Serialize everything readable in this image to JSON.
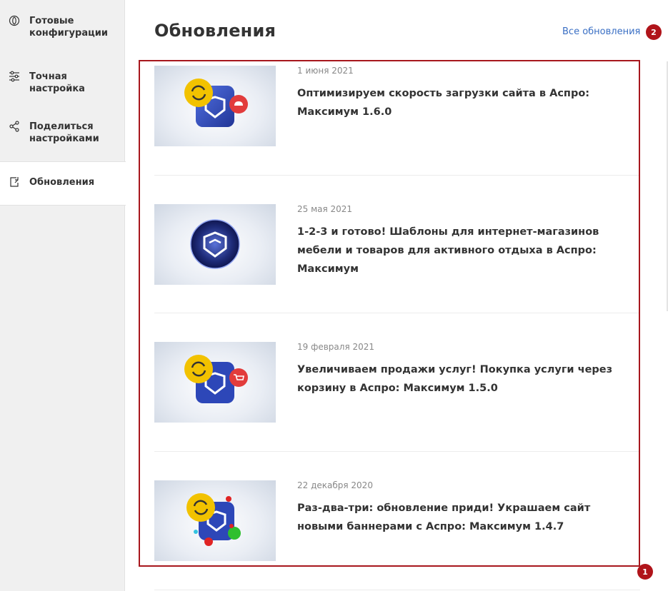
{
  "sidebar": {
    "items": [
      {
        "label_line1": "Готовые",
        "label_line2": "конфигурации",
        "icon": "palette-icon"
      },
      {
        "label_line1": "Точная",
        "label_line2": "настройка",
        "icon": "sliders-icon"
      },
      {
        "label_line1": "Поделиться",
        "label_line2": "настройками",
        "icon": "share-icon"
      },
      {
        "label_line1": "Обновления",
        "icon": "update-icon",
        "active": true
      }
    ]
  },
  "main": {
    "title": "Обновления",
    "all_updates_link": "Все обновления",
    "badges": {
      "list": "1",
      "link": "2"
    },
    "news": [
      {
        "date": "1 июня 2021",
        "title": "Оптимизируем скорость загрузки сайта в Аспро: Максимум 1.6.0"
      },
      {
        "date": "25 мая 2021",
        "title": "1-2-3 и готово! Шаблоны для интернет-магазинов мебели и товаров для активного отдыха в Аспро: Максимум"
      },
      {
        "date": "19 февраля 2021",
        "title": "Увеличиваем продажи услуг! Покупка услуги через корзину в Аспро: Максимум 1.5.0"
      },
      {
        "date": "22 декабря 2020",
        "title": "Раз-два-три: обновление приди! Украшаем сайт новыми баннерами с Аспро: Максимум 1.4.7"
      }
    ]
  },
  "colors": {
    "accent": "#3a6fc4",
    "badge": "#b0141a",
    "highlight": "#a7171d"
  }
}
